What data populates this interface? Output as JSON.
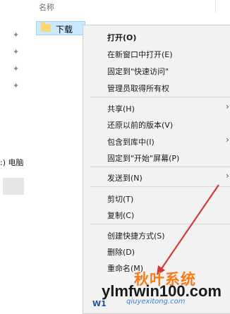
{
  "header": {
    "name_label": "名称"
  },
  "folder": {
    "label": "下载"
  },
  "left_pane": {
    "drive_label": ":) 电脑"
  },
  "context_menu": {
    "items": [
      {
        "label": "打开(O)",
        "bold": true
      },
      {
        "label": "在新窗口中打开(E)"
      },
      {
        "label": "固定到\"快速访问\""
      },
      {
        "label": "管理员取得所有权"
      },
      {
        "label": "共享(H)",
        "submenu": true
      },
      {
        "label": "还原以前的版本(V)"
      },
      {
        "label": "包含到库中(I)",
        "submenu": true
      },
      {
        "label": "固定到\"开始\"屏幕(P)"
      },
      {
        "label": "发送到(N)",
        "submenu": true
      },
      {
        "label": "剪切(T)"
      },
      {
        "label": "复制(C)"
      },
      {
        "label": "创建快捷方式(S)"
      },
      {
        "label": "删除(D)"
      },
      {
        "label": "重命名(M)"
      }
    ]
  },
  "watermark": {
    "brand_cn": "秋叶系统",
    "url": "ylmfwin100.com",
    "url_small": "qiuyexitong.com",
    "prefix": "W1"
  },
  "colors": {
    "selection": "#cce8ff",
    "menu_bg": "#f2f2f2",
    "watermark_orange": "#f57c16"
  }
}
